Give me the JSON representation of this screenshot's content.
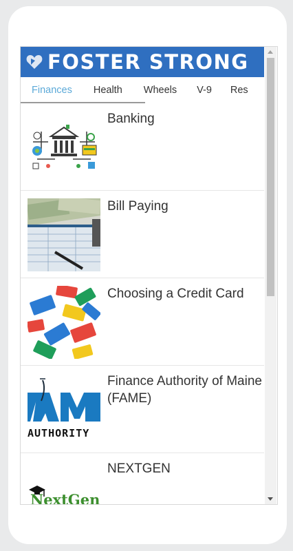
{
  "app": {
    "title": "FOSTER STRONG",
    "logo_icon": "heart-icon"
  },
  "tabs": [
    {
      "label": "Finances",
      "active": true
    },
    {
      "label": "Health",
      "active": false
    },
    {
      "label": "Wheels",
      "active": false
    },
    {
      "label": "V-9",
      "active": false
    },
    {
      "label": "Res",
      "active": false
    }
  ],
  "items": [
    {
      "title": "Banking",
      "image": "bank-illustration"
    },
    {
      "title": "Bill Paying",
      "image": "bills-photo"
    },
    {
      "title": "Choosing a Credit Card",
      "image": "credit-cards-photo"
    },
    {
      "title": "Finance Authority of Maine (FAME)",
      "image": "fame-logo",
      "logo_text": "AM",
      "logo_sub": "AUTHORITY"
    },
    {
      "title": "NEXTGEN",
      "image": "nextgen-logo",
      "logo_text": "NextGen"
    }
  ],
  "colors": {
    "banner": "#2f6fc0",
    "active_tab": "#5ba9d8",
    "fame_blue": "#1a7ac1",
    "nextgen_green": "#3d8f2f"
  }
}
